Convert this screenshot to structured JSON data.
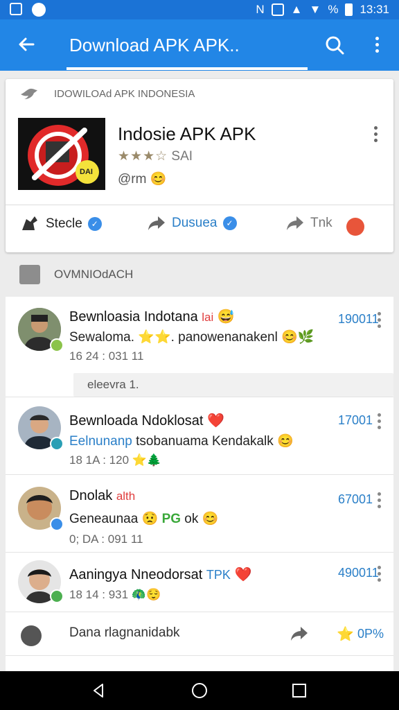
{
  "status_bar": {
    "time": "13:31",
    "battery_text": "%"
  },
  "app_bar": {
    "title": "Download APK APK..",
    "back_icon": "arrow-left-icon",
    "search_icon": "search-icon",
    "more_icon": "more-vert-icon"
  },
  "app_card": {
    "header": "IDOWILOAd APK INDONESIA",
    "app_name": "Indosie APK APK",
    "stars": "★★★☆",
    "rating_label": "SAI",
    "developer": "@rm",
    "developer_emoji": "😊",
    "logo_badge": "DAI",
    "actions": [
      {
        "label": "Stecle",
        "icon": "ninja-icon"
      },
      {
        "label": "Dusuea",
        "icon": "share-icon"
      },
      {
        "label": "Tnk",
        "icon": "share-icon"
      }
    ]
  },
  "section": {
    "title": "OVMNIOdACH"
  },
  "list": {
    "items": [
      {
        "name": "Bewnloasia Indotana",
        "name_suffix": "lai",
        "name_emoji": "😅",
        "message": "Sewaloma.",
        "message_emoji_1": "⭐⭐.",
        "message_tail": "panowenanakenl",
        "message_emoji_2": "😊🌿",
        "time": "16 24 : 031 11",
        "count": "190011"
      },
      {
        "pill": "eleevra 1."
      },
      {
        "name": "Bewnloada Ndoklosat",
        "name_emoji": "❤️",
        "message_blue": "Eelnunanp",
        "message_tail": "tsobanuama Kendakalk",
        "message_emoji_2": "😊",
        "time": "18 1A : 120",
        "time_emoji": "⭐🌲",
        "count": "17001"
      },
      {
        "name": "Dnolak",
        "name_suffix": "alth",
        "message": "Geneaunaa",
        "message_emoji_1": "😟",
        "message_green": "PG",
        "message_tail": "ok",
        "message_emoji_2": "😊",
        "time": "0; DA : 091 11",
        "count": "67001"
      },
      {
        "name": "Aaningya Nneodorsat",
        "name_suffix": "TPK",
        "name_emoji": "❤️",
        "time": "18 14 : 931",
        "time_emoji": "🦚😌",
        "count": "490011"
      },
      {
        "bottom_label": "Dana rlagnanidabk",
        "bottom_percent": "0P%",
        "bottom_emoji": "⭐"
      }
    ]
  },
  "colors": {
    "app_bar": "#2286e6",
    "status_bar": "#1b73d6",
    "accent_blue": "#2a7fc8",
    "background": "#ececec"
  }
}
